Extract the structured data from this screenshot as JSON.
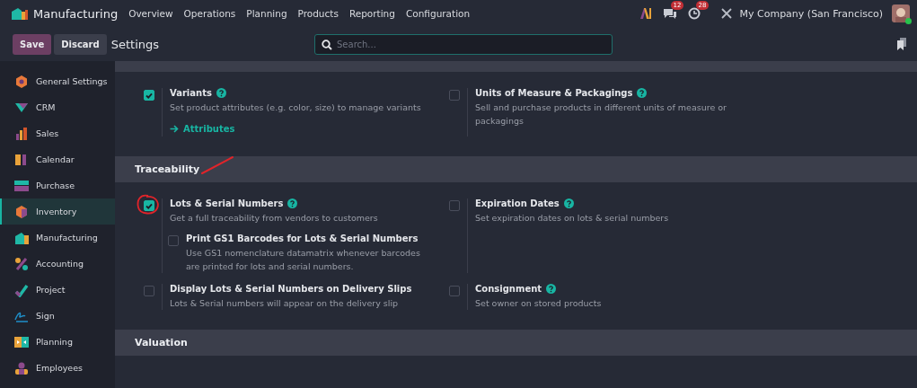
{
  "navbar": {
    "app_name": "Manufacturing",
    "menu": [
      "Overview",
      "Operations",
      "Planning",
      "Products",
      "Reporting",
      "Configuration"
    ],
    "messages_badge": "12",
    "activities_badge": "28",
    "company": "My Company (San Francisco)"
  },
  "control_panel": {
    "save": "Save",
    "discard": "Discard",
    "breadcrumb": "Settings",
    "search": {
      "placeholder": "Search..."
    }
  },
  "sidebar": {
    "items": [
      {
        "label": "General Settings",
        "selected": false
      },
      {
        "label": "CRM",
        "selected": false
      },
      {
        "label": "Sales",
        "selected": false
      },
      {
        "label": "Calendar",
        "selected": false
      },
      {
        "label": "Purchase",
        "selected": false
      },
      {
        "label": "Inventory",
        "selected": true
      },
      {
        "label": "Manufacturing",
        "selected": false
      },
      {
        "label": "Accounting",
        "selected": false
      },
      {
        "label": "Project",
        "selected": false
      },
      {
        "label": "Sign",
        "selected": false
      },
      {
        "label": "Planning",
        "selected": false
      },
      {
        "label": "Employees",
        "selected": false
      }
    ]
  },
  "sections": [
    {
      "settings": [
        {
          "label": "Variants",
          "help": true,
          "description": "Set product attributes (e.g. color, size) to manage variants",
          "checked": true,
          "link": "Attributes"
        },
        {
          "label": "Units of Measure & Packagings",
          "help": true,
          "description": "Sell and purchase products in different units of measure or packagings",
          "checked": false
        }
      ]
    },
    {
      "title": "Traceability",
      "settings": [
        {
          "label": "Lots & Serial Numbers",
          "help": true,
          "description": "Get a full traceability from vendors to customers",
          "checked": true,
          "children": [
            {
              "label": "Print GS1 Barcodes for Lots & Serial Numbers",
              "help": false,
              "description": "Use GS1 nomenclature datamatrix whenever barcodes are printed for lots and serial numbers.",
              "checked": false
            }
          ]
        },
        {
          "label": "Expiration Dates",
          "help": true,
          "description": "Set expiration dates on lots & serial numbers",
          "checked": false
        },
        {
          "label": "Display Lots & Serial Numbers on Delivery Slips",
          "help": false,
          "description": "Lots & Serial numbers will appear on the delivery slip",
          "checked": false
        },
        {
          "label": "Consignment",
          "help": true,
          "description": "Set owner on stored products",
          "checked": false
        }
      ]
    },
    {
      "title": "Valuation"
    }
  ]
}
